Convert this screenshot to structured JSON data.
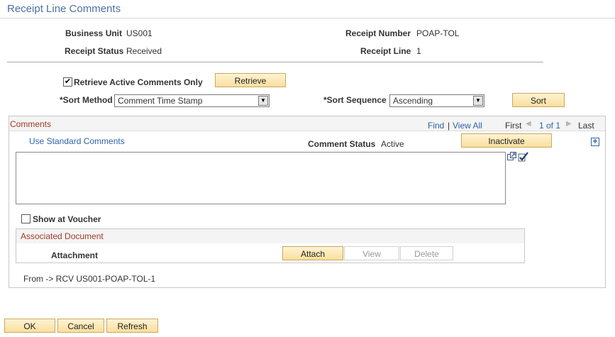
{
  "page": {
    "title": "Receipt Line Comments"
  },
  "header": {
    "business_unit_label": "Business Unit",
    "business_unit_value": "US001",
    "receipt_number_label": "Receipt Number",
    "receipt_number_value": "POAP-TOL",
    "receipt_status_label": "Receipt Status",
    "receipt_status_value": "Received",
    "receipt_line_label": "Receipt Line",
    "receipt_line_value": "1"
  },
  "filters": {
    "retrieve_active_label": "Retrieve Active Comments Only",
    "retrieve_active_checked": true,
    "check_glyph": "✔",
    "retrieve_button": "Retrieve",
    "sort_method_label": "*Sort Method",
    "sort_method_value": "Comment Time Stamp",
    "sort_sequence_label": "*Sort Sequence",
    "sort_sequence_value": "Ascending",
    "sort_button": "Sort",
    "dropdown_arrow": "▼"
  },
  "comments_grid": {
    "title": "Comments",
    "find_link": "Find",
    "nav_separator": "|",
    "view_all_link": "View All",
    "first_label": "First",
    "prev_icon": "◀",
    "page_indicator": "1 of 1",
    "next_icon": "▶",
    "last_label": "Last",
    "use_standard_comments_link": "Use Standard Comments",
    "comment_status_label": "Comment Status",
    "comment_status_value": "Active",
    "inactivate_button": "Inactivate",
    "add_row_icon": "+",
    "comment_text": "",
    "show_at_voucher_label": "Show at Voucher",
    "show_at_voucher_checked": false,
    "associated_document_title": "Associated Document",
    "attachment_label": "Attachment",
    "attach_button": "Attach",
    "view_button": "View",
    "delete_button": "Delete",
    "from_text": "From -> RCV US001-POAP-TOL-1"
  },
  "footer": {
    "ok_button": "OK",
    "cancel_button": "Cancel",
    "refresh_button": "Refresh"
  },
  "colors": {
    "title_blue": "#4e6fa6",
    "link_blue": "#3062a8",
    "grid_title_red": "#a13a2a",
    "button_gold": "#fadf9e"
  }
}
